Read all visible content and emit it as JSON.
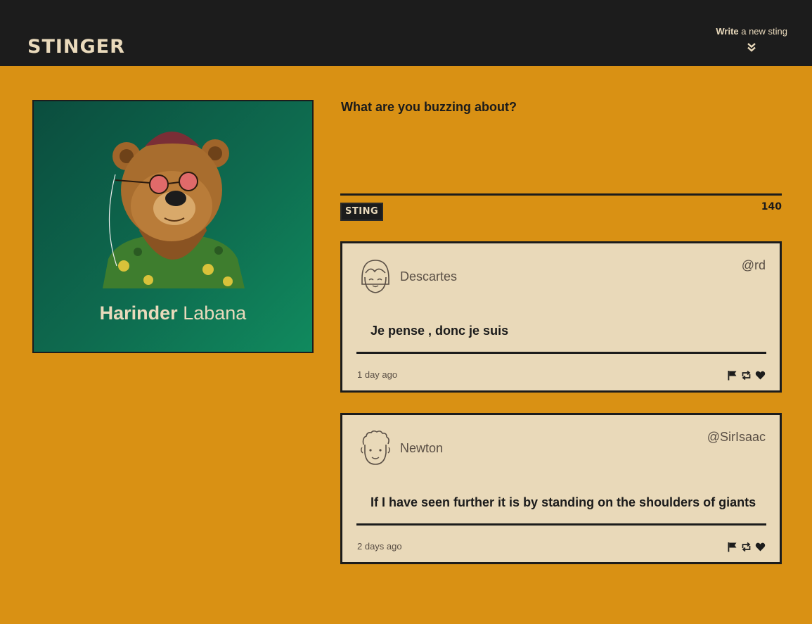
{
  "header": {
    "logo": "STINGER",
    "compose_bold": "Write",
    "compose_rest": " a new sting",
    "compose_icon": "double-chevron-down-icon"
  },
  "profile": {
    "first_name": "Harinder",
    "last_name": "Labana",
    "avatar": "bear-avatar-illustration"
  },
  "composer": {
    "placeholder": "What are you buzzing about?",
    "button_label": "STING",
    "char_count": "140"
  },
  "stings": [
    {
      "author": "Descartes",
      "handle": "@rd",
      "text": "Je pense , donc je suis",
      "time": "1 day ago",
      "avatar_icon": "girl-face-avatar-icon"
    },
    {
      "author": "Newton",
      "handle": "@SirIsaac",
      "text": "If I have seen further it is by standing on the shoulders of giants",
      "time": "2 days ago",
      "avatar_icon": "curly-hair-face-avatar-icon"
    }
  ],
  "actions": [
    "flag-icon",
    "retweet-icon",
    "heart-icon"
  ],
  "colors": {
    "background": "#d99114",
    "nav": "#1c1c1c",
    "card": "#e9d9b9",
    "cream_text": "#eadabc",
    "profile_green": "#0e6b4f"
  }
}
